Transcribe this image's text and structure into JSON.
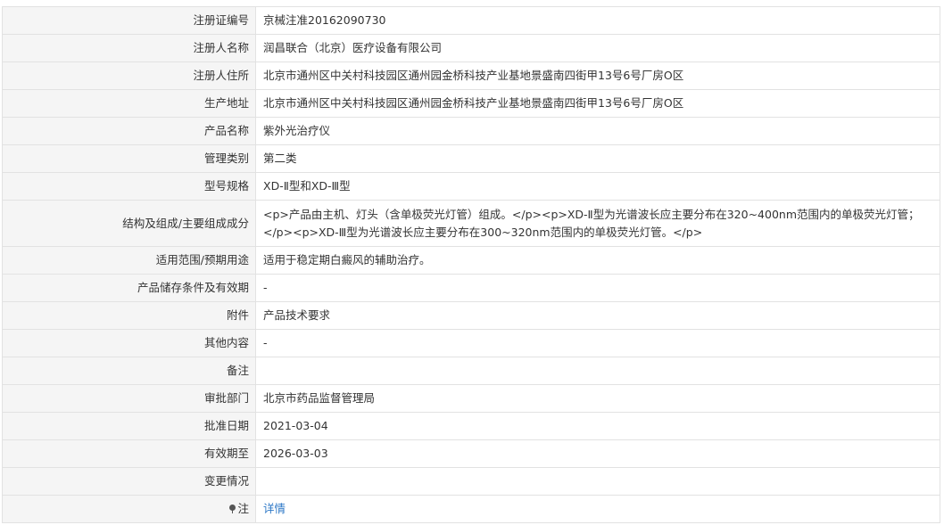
{
  "rows": [
    {
      "label": "注册证编号",
      "value": "京械注准20162090730"
    },
    {
      "label": "注册人名称",
      "value": "润昌联合（北京）医疗设备有限公司"
    },
    {
      "label": "注册人住所",
      "value": "北京市通州区中关村科技园区通州园金桥科技产业基地景盛南四街甲13号6号厂房O区"
    },
    {
      "label": "生产地址",
      "value": "北京市通州区中关村科技园区通州园金桥科技产业基地景盛南四街甲13号6号厂房O区"
    },
    {
      "label": "产品名称",
      "value": "紫外光治疗仪"
    },
    {
      "label": "管理类别",
      "value": "第二类"
    },
    {
      "label": "型号规格",
      "value": "XD-Ⅱ型和XD-Ⅲ型"
    },
    {
      "label": "结构及组成/主要组成成分",
      "value": "<p>产品由主机、灯头（含单极荧光灯管）组成。</p><p>XD-Ⅱ型为光谱波长应主要分布在320~400nm范围内的单极荧光灯管；</p><p>XD-Ⅲ型为光谱波长应主要分布在300~320nm范围内的单极荧光灯管。</p>"
    },
    {
      "label": "适用范围/预期用途",
      "value": "适用于稳定期白癜风的辅助治疗。"
    },
    {
      "label": "产品储存条件及有效期",
      "value": "-"
    },
    {
      "label": "附件",
      "value": "产品技术要求"
    },
    {
      "label": "其他内容",
      "value": "-"
    },
    {
      "label": "备注",
      "value": ""
    },
    {
      "label": "审批部门",
      "value": "北京市药品监督管理局"
    },
    {
      "label": "批准日期",
      "value": "2021-03-04"
    },
    {
      "label": "有效期至",
      "value": "2026-03-03"
    },
    {
      "label": "变更情况",
      "value": ""
    }
  ],
  "note": {
    "label": "注",
    "icon": "pin-icon",
    "link": "详情",
    "link_color": "#2a76c6"
  }
}
